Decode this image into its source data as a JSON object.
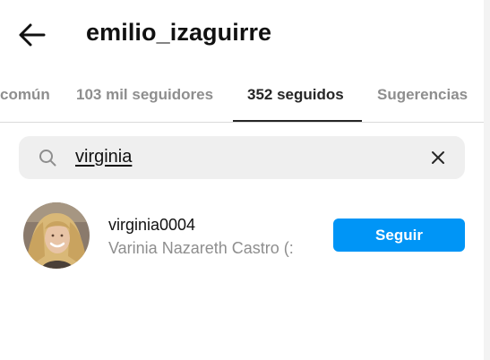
{
  "header": {
    "back_icon": "arrow-left-icon",
    "title": "emilio_izaguirre"
  },
  "tabs": [
    {
      "label": "común",
      "active": false
    },
    {
      "label": "103 mil seguidores",
      "active": false
    },
    {
      "label": "352 seguidos",
      "active": true
    },
    {
      "label": "Sugerencias",
      "active": false
    }
  ],
  "search": {
    "icon": "search-icon",
    "value": "virginia",
    "clear_icon": "close-icon"
  },
  "results": [
    {
      "username": "virginia0004",
      "full_name": "Varinia Nazareth Castro (:",
      "button_label": "Seguir"
    }
  ],
  "colors": {
    "accent": "#0095f6",
    "text_primary": "#262626",
    "text_secondary": "#8e8e8e",
    "search_bg": "#efefef"
  }
}
